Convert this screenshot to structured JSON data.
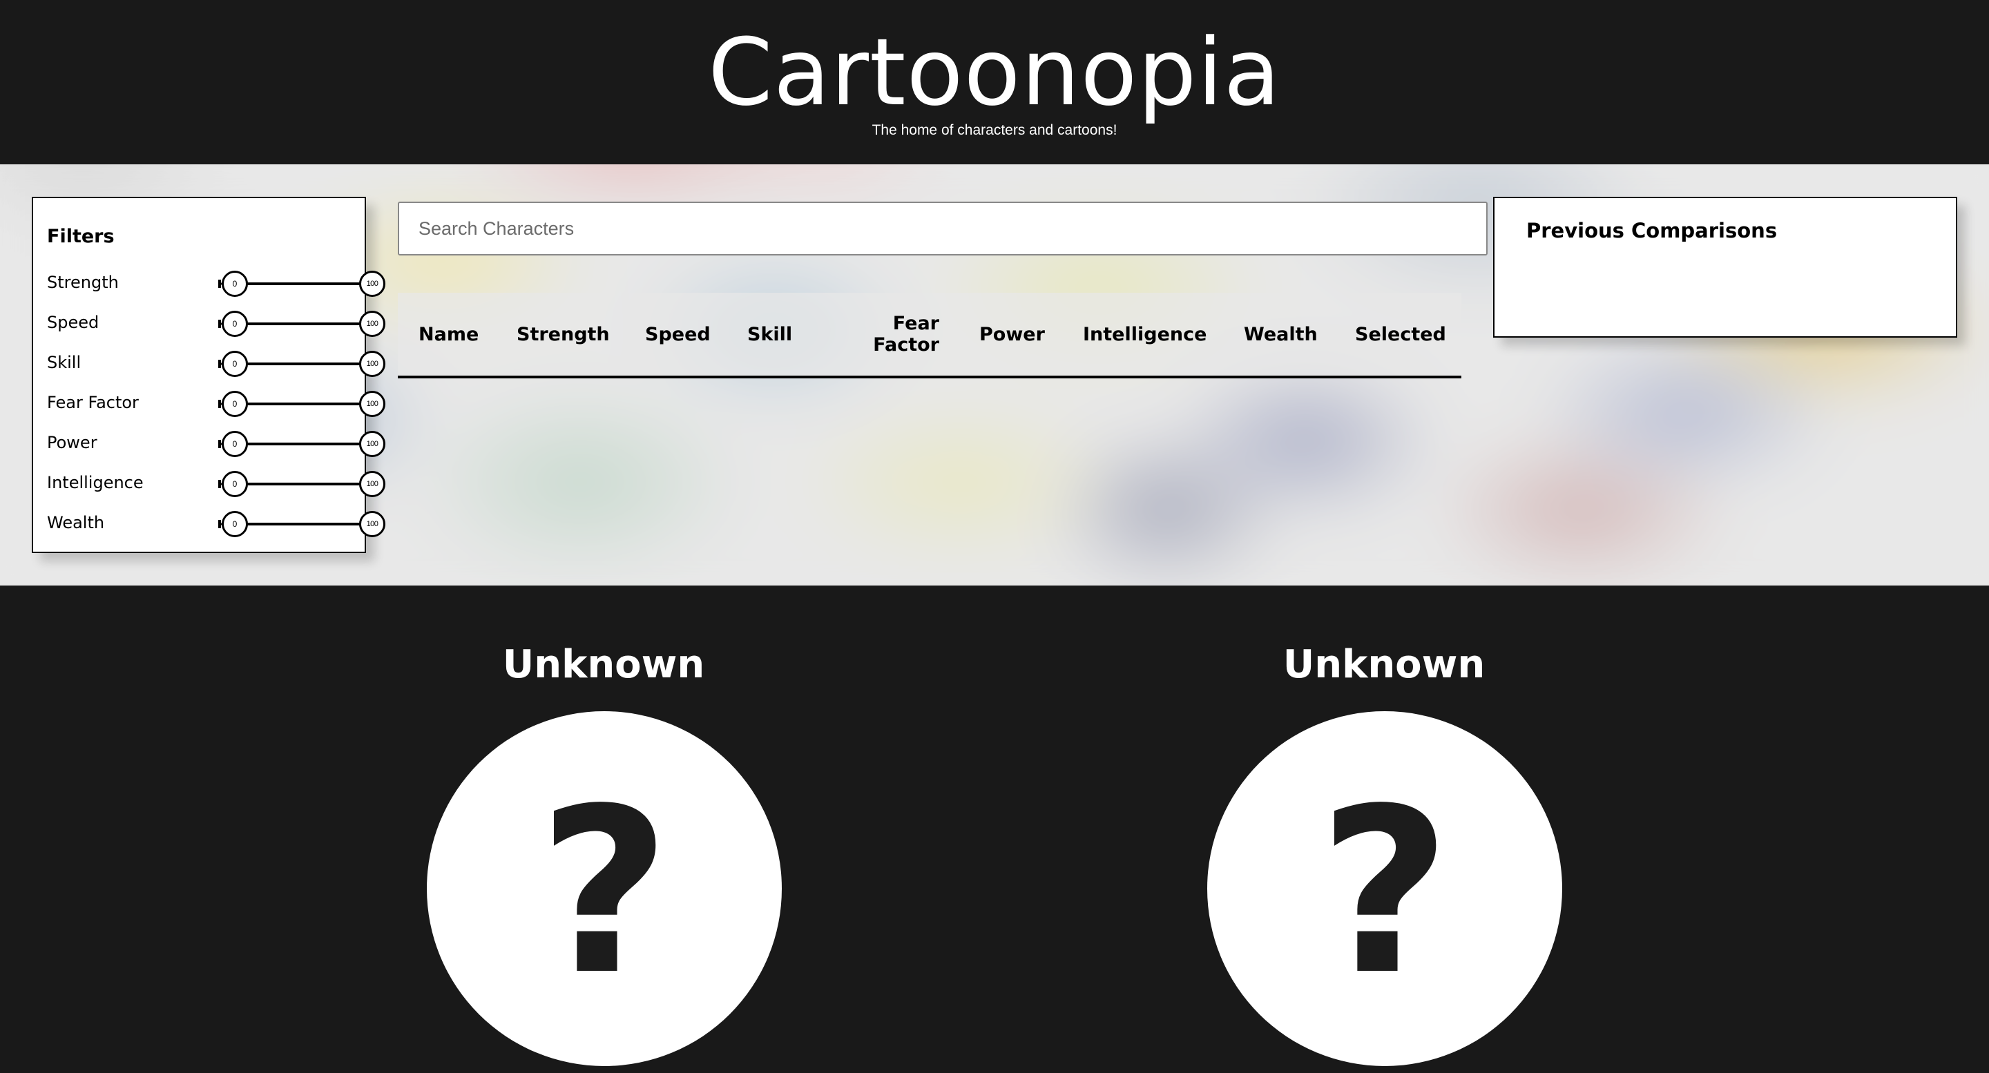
{
  "header": {
    "title": "Cartoonopia",
    "tagline": "The home of characters and cartoons!"
  },
  "filters": {
    "title": "Filters",
    "items": [
      {
        "label": "Strength",
        "min": "0",
        "max": "100"
      },
      {
        "label": "Speed",
        "min": "0",
        "max": "100"
      },
      {
        "label": "Skill",
        "min": "0",
        "max": "100"
      },
      {
        "label": "Fear Factor",
        "min": "0",
        "max": "100"
      },
      {
        "label": "Power",
        "min": "0",
        "max": "100"
      },
      {
        "label": "Intelligence",
        "min": "0",
        "max": "100"
      },
      {
        "label": "Wealth",
        "min": "0",
        "max": "100"
      }
    ]
  },
  "search": {
    "placeholder": "Search Characters",
    "value": ""
  },
  "table": {
    "columns": [
      "Name",
      "Strength",
      "Speed",
      "Skill",
      "Fear Factor",
      "Power",
      "Intelligence",
      "Wealth",
      "Selected"
    ],
    "rows": []
  },
  "previous": {
    "title": "Previous Comparisons",
    "items": []
  },
  "comparison": {
    "left": {
      "name": "Unknown",
      "placeholder_glyph": "?"
    },
    "right": {
      "name": "Unknown",
      "placeholder_glyph": "?"
    }
  },
  "icons": {
    "placeholder": "question-mark-icon"
  },
  "colors": {
    "background": "#191919",
    "panel": "#ffffff",
    "text_light": "#ffffff",
    "text_dark": "#000000"
  }
}
